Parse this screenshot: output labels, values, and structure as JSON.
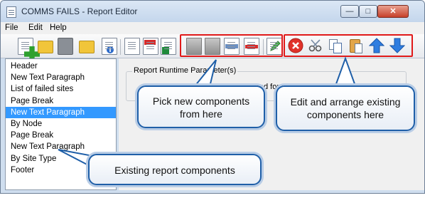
{
  "window": {
    "title": "COMMS FAILS - Report Editor",
    "minimize_glyph": "—",
    "maximize_glyph": "□",
    "close_glyph": "✕"
  },
  "menu": [
    "File",
    "Edit",
    "Help"
  ],
  "toolbar": {
    "file_icons": [
      "new-document-icon",
      "open-folder-icon",
      "save-disk-icon",
      "folder-icon",
      "info-document-icon"
    ],
    "export_icons": [
      "page-icon",
      "pdf-export-icon",
      "excel-export-icon"
    ],
    "component_icons": [
      "header-component-icon",
      "text-paragraph-component-icon",
      "list-component-icon",
      "page-break-component-icon",
      "edit-component-icon"
    ],
    "edit_icons": [
      "delete-icon",
      "cut-icon",
      "copy-icon",
      "paste-icon",
      "move-up-icon",
      "move-down-icon"
    ]
  },
  "components": [
    "Header",
    "New Text Paragraph",
    "List of failed sites",
    "Page Break",
    "New Text Paragraph",
    "By Node",
    "Page Break",
    "New Text Paragraph",
    "By Site Type",
    "Footer"
  ],
  "selected_index": 4,
  "params": {
    "group_label": "Report Runtime Parameter(s)",
    "message": "No parameters are required for this"
  },
  "callouts": {
    "pick_line1": "Pick new components",
    "pick_line2": "from here",
    "edit_line1": "Edit and arrange existing",
    "edit_line2": "components here",
    "existing": "Existing report components"
  },
  "colors": {
    "highlight": "#e01919",
    "selection": "#3399ff",
    "callout_border": "#1f5fa8"
  }
}
